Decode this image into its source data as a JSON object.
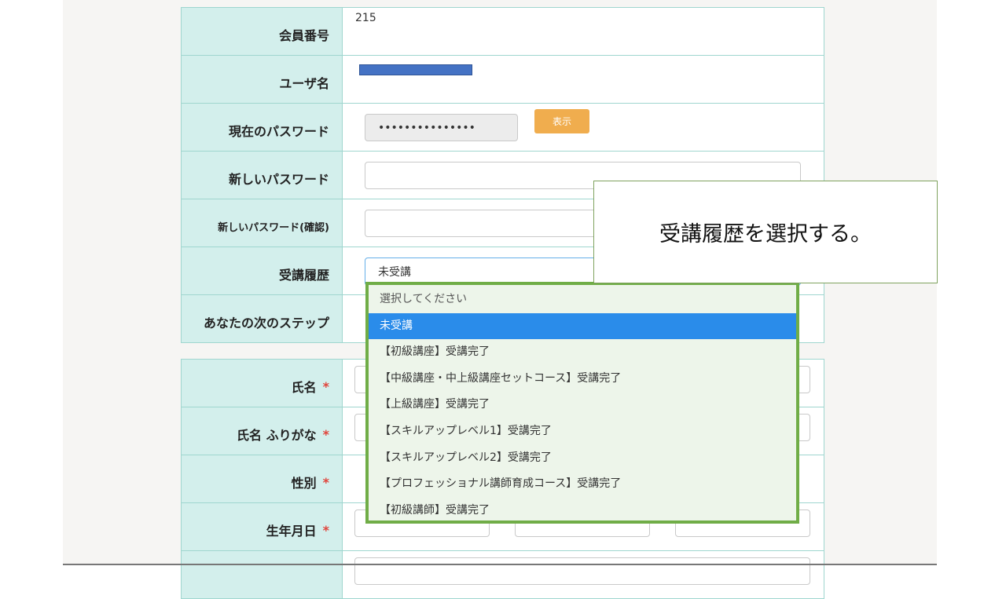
{
  "account_section": {
    "member_number": {
      "label": "会員番号",
      "value": "215"
    },
    "username": {
      "label": "ユーザ名"
    },
    "current_password": {
      "label": "現在のパスワード",
      "value": "•••••••••••••••",
      "show_button": "表示"
    },
    "new_password": {
      "label": "新しいパスワード"
    },
    "new_password_confirm": {
      "label": "新しいパスワード(確認)"
    },
    "course_history": {
      "label": "受講履歴",
      "value": "未受講"
    },
    "next_step": {
      "label": "あなたの次のステップ"
    }
  },
  "dropdown": {
    "options": [
      "選択してください",
      "未受講",
      "【初級講座】受講完了",
      "【中級講座・中上級講座セットコース】受講完了",
      "【上級講座】受講完了",
      "【スキルアップレベル1】受講完了",
      "【スキルアップレベル2】受講完了",
      "【プロフェッショナル講師育成コース】受講完了",
      "【初級講師】受講完了"
    ],
    "selected_index": 1
  },
  "profile_section": {
    "name": {
      "label": "氏名",
      "required": "*"
    },
    "name_kana": {
      "label": "氏名 ふりがな",
      "required": "*"
    },
    "gender": {
      "label": "性別",
      "required": "*"
    },
    "birthdate": {
      "label": "生年月日",
      "required": "*"
    }
  },
  "callout": {
    "text": "受講履歴を選択する。"
  },
  "colors": {
    "label_bg": "#d3efec",
    "border": "#9fd6cf",
    "show_button": "#f0ad4e",
    "dropdown_border": "#70ad47",
    "selected_option": "#2a8cea",
    "required": "#e0443b"
  }
}
